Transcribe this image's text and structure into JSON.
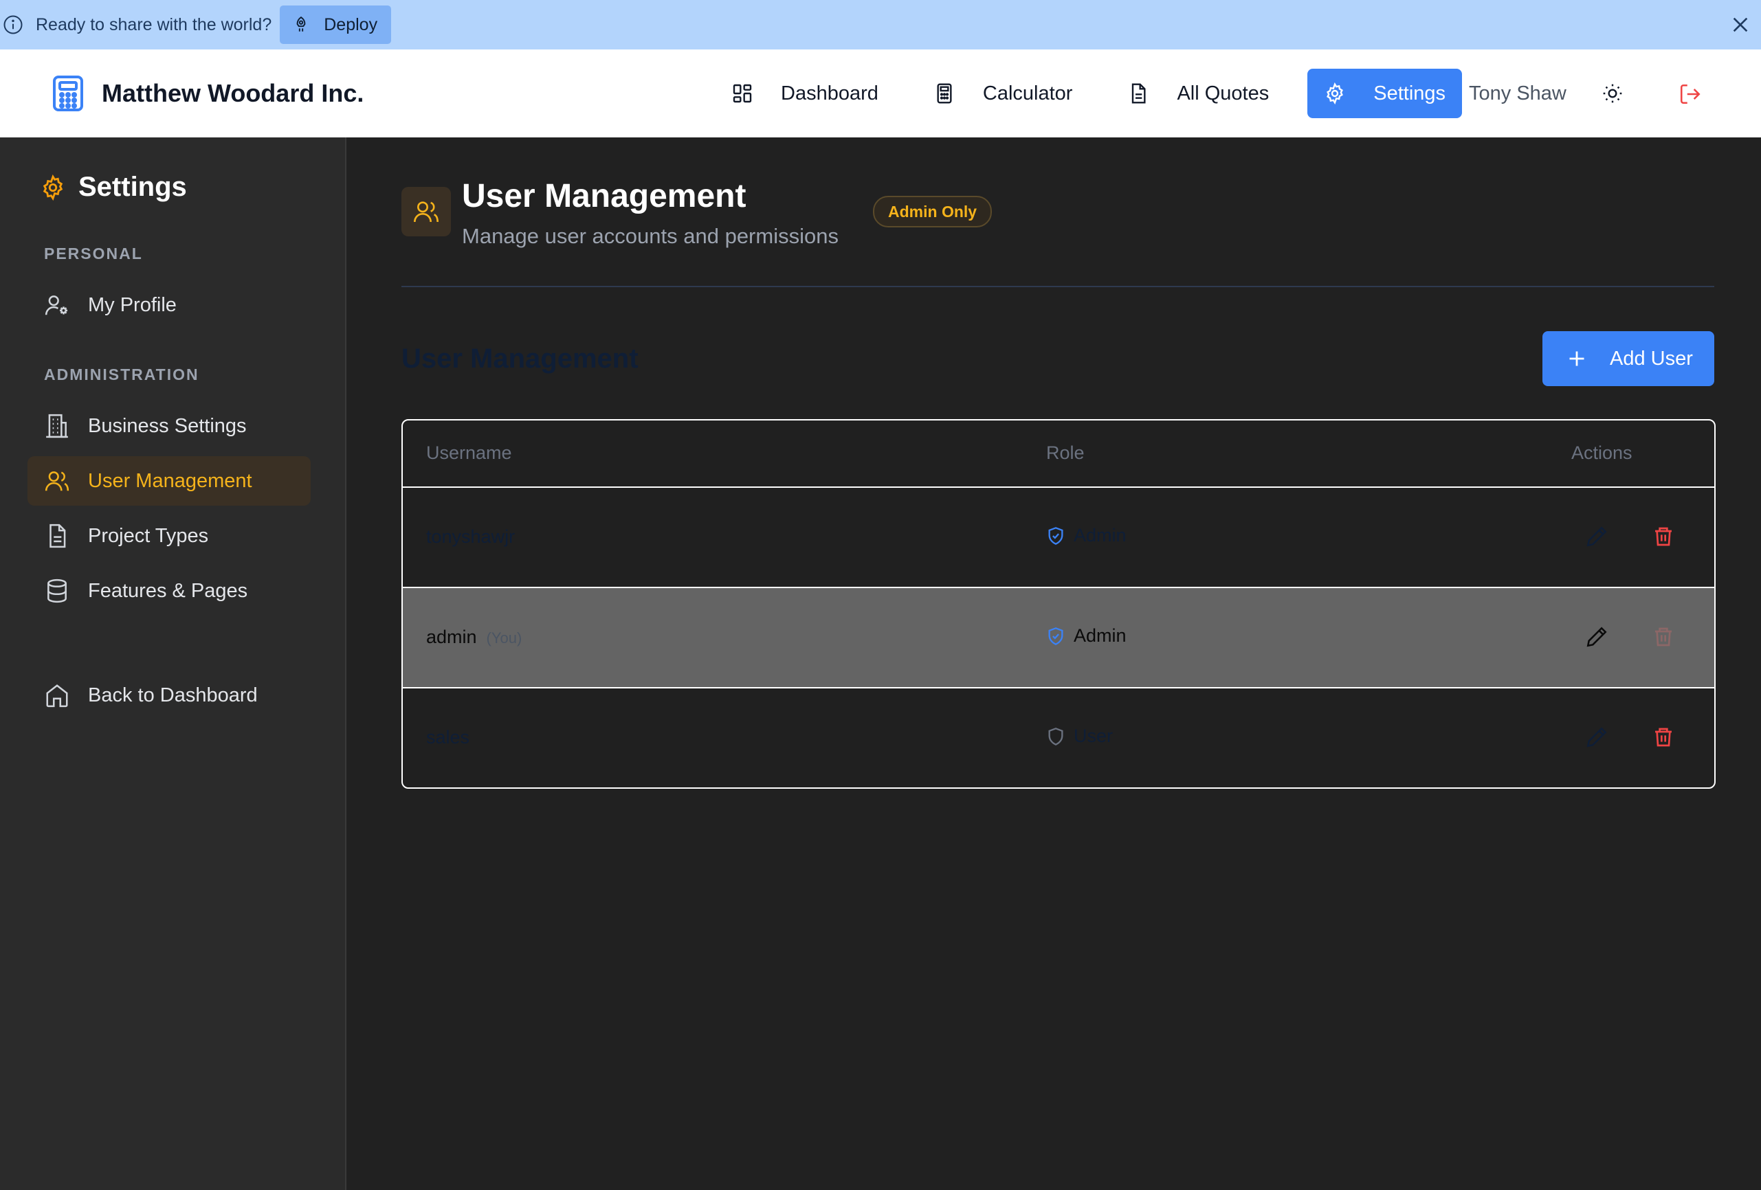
{
  "banner": {
    "message": "Ready to share with the world?",
    "deploy_label": "Deploy"
  },
  "header": {
    "brand_name": "Matthew Woodard Inc.",
    "nav": [
      {
        "label": "Dashboard",
        "icon": "dashboard-icon"
      },
      {
        "label": "Calculator",
        "icon": "calculator-icon"
      },
      {
        "label": "All Quotes",
        "icon": "document-icon"
      },
      {
        "label": "Settings",
        "icon": "gear-icon",
        "active": true
      }
    ],
    "user_name": "Tony Shaw"
  },
  "sidebar": {
    "title": "Settings",
    "sections": {
      "personal": "PERSONAL",
      "administration": "ADMINISTRATION"
    },
    "items": [
      {
        "label": "My Profile",
        "icon": "user-gear-icon"
      },
      {
        "label": "Business Settings",
        "icon": "building-icon"
      },
      {
        "label": "User Management",
        "icon": "users-icon",
        "active": true
      },
      {
        "label": "Project Types",
        "icon": "document-icon"
      },
      {
        "label": "Features & Pages",
        "icon": "database-icon"
      }
    ],
    "back_label": "Back to Dashboard"
  },
  "main": {
    "title": "User Management",
    "subtitle": "Manage user accounts and permissions",
    "badge": "Admin Only",
    "section_title": "User Management",
    "add_user_label": "Add User",
    "table": {
      "headers": [
        "Username",
        "Role",
        "Actions"
      ],
      "rows": [
        {
          "username": "tonyshawjr",
          "you": "",
          "role": "Admin"
        },
        {
          "username": "admin",
          "you": "(You)",
          "role": "Admin"
        },
        {
          "username": "sales",
          "you": "",
          "role": "User"
        }
      ]
    }
  },
  "colors": {
    "accent": "#3b82f6",
    "amber": "#f5b31b",
    "danger": "#ef4444",
    "banner": "#b3d4fc"
  }
}
